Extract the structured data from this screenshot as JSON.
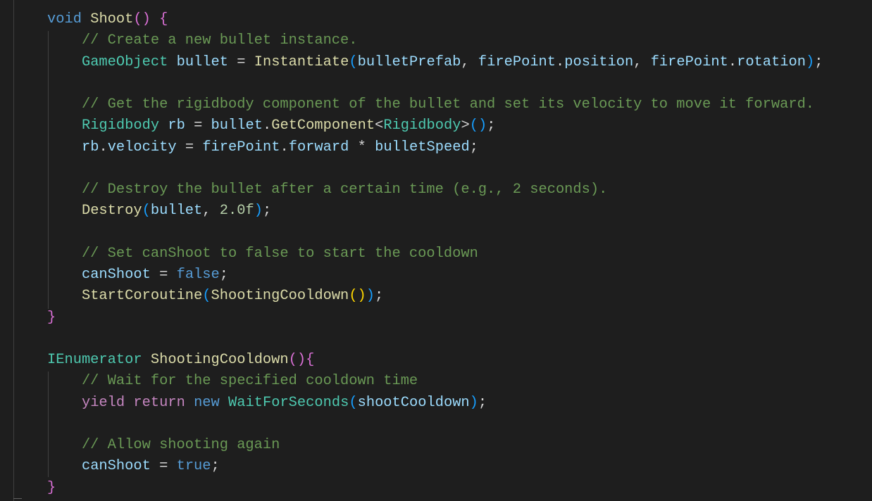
{
  "editor": {
    "language": "csharp",
    "lines": [
      [
        [
          "void",
          "kw"
        ],
        [
          " ",
          "p"
        ],
        [
          "Shoot",
          "fn"
        ],
        [
          "()",
          "b1"
        ],
        [
          " ",
          "p"
        ],
        [
          "{",
          "b1"
        ]
      ],
      [
        [
          "    // Create a new bullet instance.",
          "cm"
        ]
      ],
      [
        [
          "    ",
          "p"
        ],
        [
          "GameObject",
          "type"
        ],
        [
          " ",
          "p"
        ],
        [
          "bullet",
          "var"
        ],
        [
          " = ",
          "p"
        ],
        [
          "Instantiate",
          "fn"
        ],
        [
          "(",
          "b2"
        ],
        [
          "bulletPrefab",
          "var"
        ],
        [
          ", ",
          "p"
        ],
        [
          "firePoint",
          "var"
        ],
        [
          ".",
          "p"
        ],
        [
          "position",
          "var"
        ],
        [
          ", ",
          "p"
        ],
        [
          "firePoint",
          "var"
        ],
        [
          ".",
          "p"
        ],
        [
          "rotation",
          "var"
        ],
        [
          ")",
          "b2"
        ],
        [
          ";",
          "p"
        ]
      ],
      [],
      [
        [
          "    // Get the rigidbody component of the bullet and set its velocity to move it forward.",
          "cm"
        ]
      ],
      [
        [
          "    ",
          "p"
        ],
        [
          "Rigidbody",
          "type"
        ],
        [
          " ",
          "p"
        ],
        [
          "rb",
          "var"
        ],
        [
          " = ",
          "p"
        ],
        [
          "bullet",
          "var"
        ],
        [
          ".",
          "p"
        ],
        [
          "GetComponent",
          "fn"
        ],
        [
          "<",
          "p"
        ],
        [
          "Rigidbody",
          "type"
        ],
        [
          ">",
          "p"
        ],
        [
          "()",
          "b2"
        ],
        [
          ";",
          "p"
        ]
      ],
      [
        [
          "    ",
          "p"
        ],
        [
          "rb",
          "var"
        ],
        [
          ".",
          "p"
        ],
        [
          "velocity",
          "var"
        ],
        [
          " = ",
          "p"
        ],
        [
          "firePoint",
          "var"
        ],
        [
          ".",
          "p"
        ],
        [
          "forward",
          "var"
        ],
        [
          " * ",
          "p"
        ],
        [
          "bulletSpeed",
          "var"
        ],
        [
          ";",
          "p"
        ]
      ],
      [],
      [
        [
          "    // Destroy the bullet after a certain time (e.g., 2 seconds).",
          "cm"
        ]
      ],
      [
        [
          "    ",
          "p"
        ],
        [
          "Destroy",
          "fn"
        ],
        [
          "(",
          "b2"
        ],
        [
          "bullet",
          "var"
        ],
        [
          ", ",
          "p"
        ],
        [
          "2.0f",
          "num"
        ],
        [
          ")",
          "b2"
        ],
        [
          ";",
          "p"
        ]
      ],
      [],
      [
        [
          "    // Set canShoot to false to start the cooldown",
          "cm"
        ]
      ],
      [
        [
          "    ",
          "p"
        ],
        [
          "canShoot",
          "var"
        ],
        [
          " = ",
          "p"
        ],
        [
          "false",
          "kw"
        ],
        [
          ";",
          "p"
        ]
      ],
      [
        [
          "    ",
          "p"
        ],
        [
          "StartCoroutine",
          "fn"
        ],
        [
          "(",
          "b2"
        ],
        [
          "ShootingCooldown",
          "fn"
        ],
        [
          "()",
          "b3"
        ],
        [
          ")",
          "b2"
        ],
        [
          ";",
          "p"
        ]
      ],
      [
        [
          "}",
          "b1"
        ]
      ],
      [],
      [
        [
          "IEnumerator",
          "type"
        ],
        [
          " ",
          "p"
        ],
        [
          "ShootingCooldown",
          "fn"
        ],
        [
          "()",
          "b1"
        ],
        [
          "{",
          "b1"
        ]
      ],
      [
        [
          "    // Wait for the specified cooldown time",
          "cm"
        ]
      ],
      [
        [
          "    ",
          "p"
        ],
        [
          "yield",
          "ctrl"
        ],
        [
          " ",
          "p"
        ],
        [
          "return",
          "ctrl"
        ],
        [
          " ",
          "p"
        ],
        [
          "new",
          "kw"
        ],
        [
          " ",
          "p"
        ],
        [
          "WaitForSeconds",
          "type"
        ],
        [
          "(",
          "b2"
        ],
        [
          "shootCooldown",
          "var"
        ],
        [
          ")",
          "b2"
        ],
        [
          ";",
          "p"
        ]
      ],
      [],
      [
        [
          "    // Allow shooting again",
          "cm"
        ]
      ],
      [
        [
          "    ",
          "p"
        ],
        [
          "canShoot",
          "var"
        ],
        [
          " = ",
          "p"
        ],
        [
          "true",
          "kw"
        ],
        [
          ";",
          "p"
        ]
      ],
      [
        [
          "}",
          "b1"
        ]
      ]
    ]
  }
}
